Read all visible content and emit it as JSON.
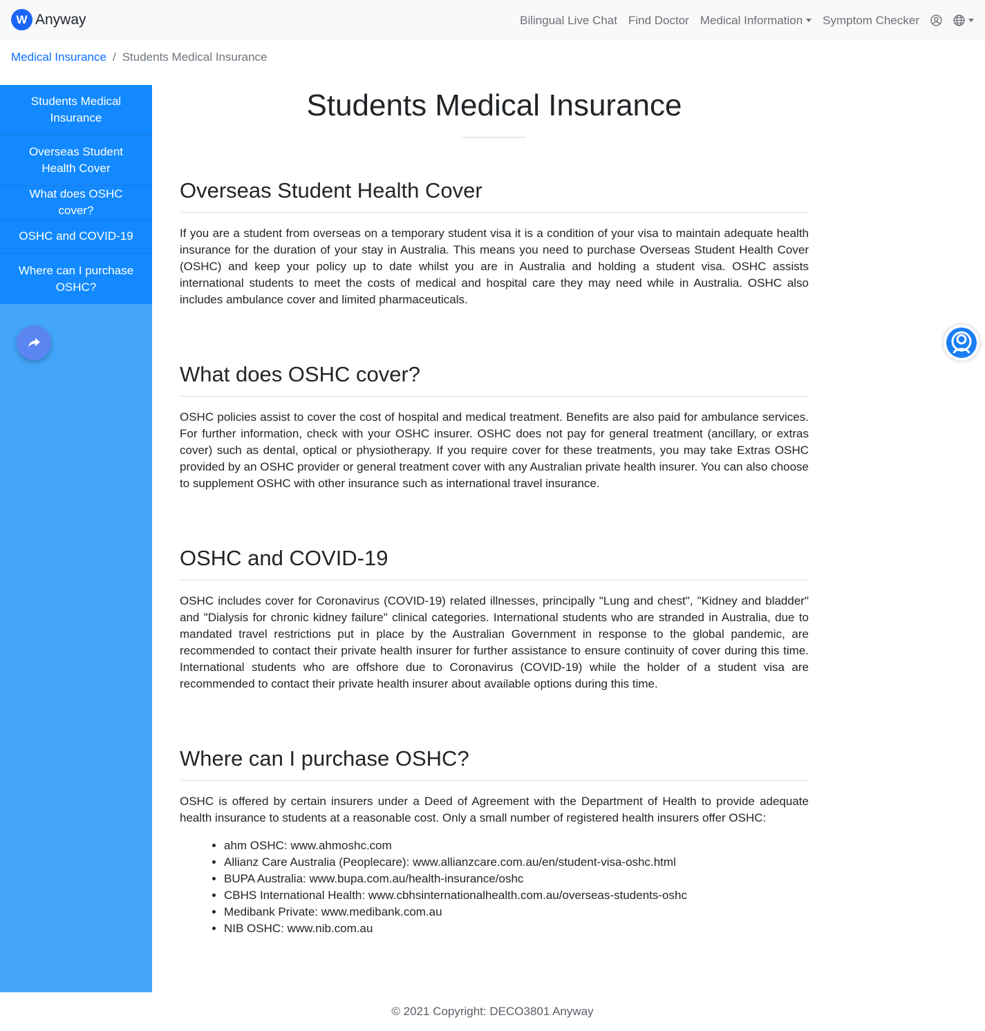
{
  "navbar": {
    "brand_logo_letter": "W",
    "brand_name": "Anyway",
    "links": {
      "live_chat": "Bilingual Live Chat",
      "find_doctor": "Find Doctor",
      "medical_info": "Medical Information",
      "symptom_checker": "Symptom Checker"
    },
    "icons": [
      "user-icon",
      "globe-icon"
    ]
  },
  "breadcrumb": {
    "parent": "Medical Insurance",
    "separator": "/",
    "current": "Students Medical Insurance"
  },
  "sidebar": {
    "items": [
      {
        "label": "Students Medical Insurance"
      },
      {
        "label": "Overseas Student Health Cover"
      },
      {
        "label": "What does OSHC cover?"
      },
      {
        "label": "OSHC and COVID-19"
      },
      {
        "label": "Where can I purchase OSHC?"
      }
    ],
    "share_icon": "share-icon"
  },
  "main": {
    "title": "Students Medical Insurance",
    "sections": [
      {
        "heading": "Overseas Student Health Cover",
        "text": "If you are a student from overseas on a temporary student visa it is a condition of your visa to maintain adequate health insurance for the duration of your stay in Australia. This means you need to purchase Overseas Student Health Cover (OSHC) and keep your policy up to date whilst you are in Australia and holding a student visa. OSHC assists international students to meet the costs of medical and hospital care they may need while in Australia. OSHC also includes ambulance cover and limited pharmaceuticals."
      },
      {
        "heading": "What does OSHC cover?",
        "text": "OSHC policies assist to cover the cost of hospital and medical treatment. Benefits are also paid for ambulance services. For further information, check with your OSHC insurer. OSHC does not pay for general treatment (ancillary, or extras cover) such as dental, optical or physiotherapy. If you require cover for these treatments, you may take Extras OSHC provided by an OSHC provider or general treatment cover with any Australian private health insurer. You can also choose to supplement OSHC with other insurance such as international travel insurance."
      },
      {
        "heading": "OSHC and COVID-19",
        "text": "OSHC includes cover for Coronavirus (COVID-19) related illnesses, principally \"Lung and chest\", \"Kidney and bladder\" and \"Dialysis for chronic kidney failure\" clinical categories. International students who are stranded in Australia, due to mandated travel restrictions put in place by the Australian Government in response to the global pandemic, are recommended to contact their private health insurer for further assistance to ensure continuity of cover during this time. International students who are offshore due to Coronavirus (COVID-19) while the holder of a student visa are recommended to contact their private health insurer about available options during this time."
      },
      {
        "heading": "Where can I purchase OSHC?",
        "text": "OSHC is offered by certain insurers under a Deed of Agreement with the Department of Health to provide adequate health insurance to students at a reasonable cost. Only a small number of registered health insurers offer OSHC:",
        "list": [
          "ahm OSHC: www.ahmoshc.com",
          "Allianz Care Australia (Peoplecare): www.allianzcare.com.au/en/student-visa-oshc.html",
          "BUPA Australia: www.bupa.com.au/health-insurance/oshc",
          "CBHS International Health: www.cbhsinternationalhealth.com.au/overseas-students-oshc",
          "Medibank Private: www.medibank.com.au",
          "NIB OSHC: www.nib.com.au"
        ]
      }
    ]
  },
  "footer": {
    "copyright": "© 2021 Copyright: DECO3801 Anyway"
  },
  "floating": {
    "chat_icon": "support-agent-icon"
  },
  "colors": {
    "brand": "#1a66f5",
    "sidebar_menu": "#1289fe",
    "sidebar_bg": "#43a6f8",
    "link": "#0d6efd"
  }
}
